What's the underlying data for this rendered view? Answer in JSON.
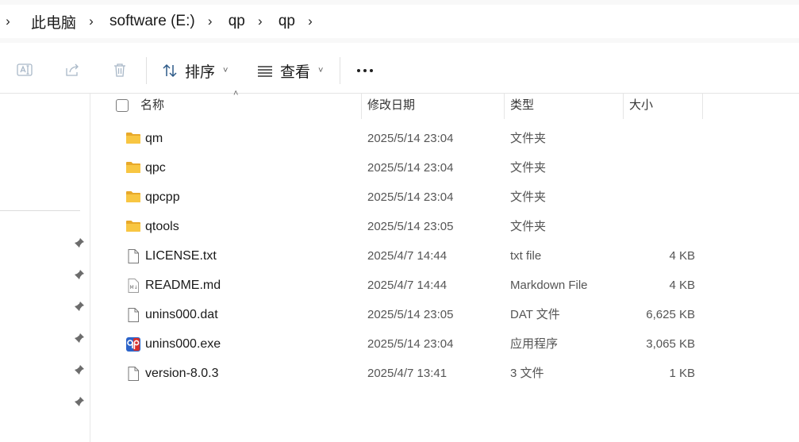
{
  "breadcrumb": {
    "items": [
      "此电脑",
      "software (E:)",
      "qp",
      "qp"
    ]
  },
  "toolbar": {
    "sort_label": "排序",
    "view_label": "查看"
  },
  "columns": {
    "name": "名称",
    "date": "修改日期",
    "type": "类型",
    "size": "大小"
  },
  "files": [
    {
      "name": "qm",
      "date": "2025/5/14 23:04",
      "type": "文件夹",
      "size": "",
      "icon": "folder-icon"
    },
    {
      "name": "qpc",
      "date": "2025/5/14 23:04",
      "type": "文件夹",
      "size": "",
      "icon": "folder-icon"
    },
    {
      "name": "qpcpp",
      "date": "2025/5/14 23:04",
      "type": "文件夹",
      "size": "",
      "icon": "folder-icon"
    },
    {
      "name": "qtools",
      "date": "2025/5/14 23:05",
      "type": "文件夹",
      "size": "",
      "icon": "folder-icon"
    },
    {
      "name": "LICENSE.txt",
      "date": "2025/4/7 14:44",
      "type": "txt file",
      "size": "4 KB",
      "icon": "file-icon"
    },
    {
      "name": "README.md",
      "date": "2025/4/7 14:44",
      "type": "Markdown File",
      "size": "4 KB",
      "icon": "markdown-file-icon"
    },
    {
      "name": "unins000.dat",
      "date": "2025/5/14 23:05",
      "type": "DAT 文件",
      "size": "6,625 KB",
      "icon": "file-icon"
    },
    {
      "name": "unins000.exe",
      "date": "2025/5/14 23:04",
      "type": "应用程序",
      "size": "3,065 KB",
      "icon": "app-icon"
    },
    {
      "name": "version-8.0.3",
      "date": "2025/4/7 13:41",
      "type": "3 文件",
      "size": "1 KB",
      "icon": "file-icon"
    }
  ],
  "colors": {
    "folder": "#f8c642",
    "folder_dark": "#e8a92a",
    "app_blue": "#2b63c9",
    "app_red": "#d9302b"
  }
}
